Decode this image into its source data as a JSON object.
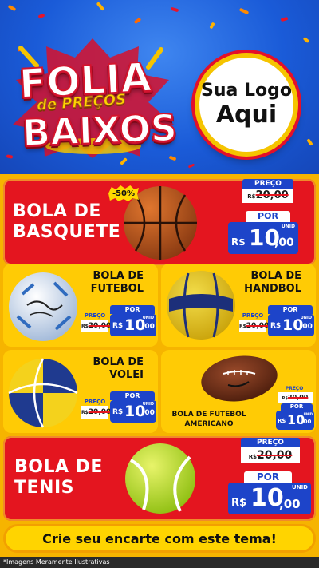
{
  "header": {
    "logo_word_1": "FOLIA",
    "logo_word_2": "de PREÇOS",
    "logo_word_3": "BAIXOS",
    "brand_line_1": "Sua Logo",
    "brand_line_2": "Aqui"
  },
  "price_labels": {
    "preco": "PREÇO",
    "por": "POR",
    "currency": "R$",
    "unit": "UNID"
  },
  "products": [
    {
      "title_1": "BOLA DE",
      "title_2": "BASQUETE",
      "old_price": "20,00",
      "new_int": "10",
      "new_dec": ",00",
      "discount": "-50%",
      "ball": "basketball-icon"
    },
    {
      "title_1": "BOLA DE",
      "title_2": "FUTEBOL",
      "old_price": "20,00",
      "new_int": "10",
      "new_dec": ",00",
      "ball": "soccer-ball-icon"
    },
    {
      "title_1": "BOLA DE",
      "title_2": "HANDBOL",
      "old_price": "20,00",
      "new_int": "10",
      "new_dec": ",00",
      "ball": "handball-icon"
    },
    {
      "title_1": "BOLA DE",
      "title_2": "VOLEI",
      "old_price": "20,00",
      "new_int": "10",
      "new_dec": ",00",
      "ball": "volleyball-icon"
    },
    {
      "title_1": "BOLA DE FUTEBOL",
      "title_2": "AMERICANO",
      "old_price": "20,00",
      "new_int": "10",
      "new_dec": ",00",
      "ball": "american-football-icon"
    },
    {
      "title_1": "BOLA DE",
      "title_2": "TENIS",
      "old_price": "20,00",
      "new_int": "10",
      "new_dec": ",00",
      "ball": "tennis-ball-icon"
    }
  ],
  "cta": "Crie seu encarte com este tema!",
  "footer": "*Imagens Meramente Ilustrativas",
  "colors": {
    "header_blue": "#1a5bd8",
    "body_yellow": "#f6b400",
    "card_red": "#e4151f",
    "card_yellow": "#ffcb05",
    "price_blue": "#1d44c9"
  }
}
